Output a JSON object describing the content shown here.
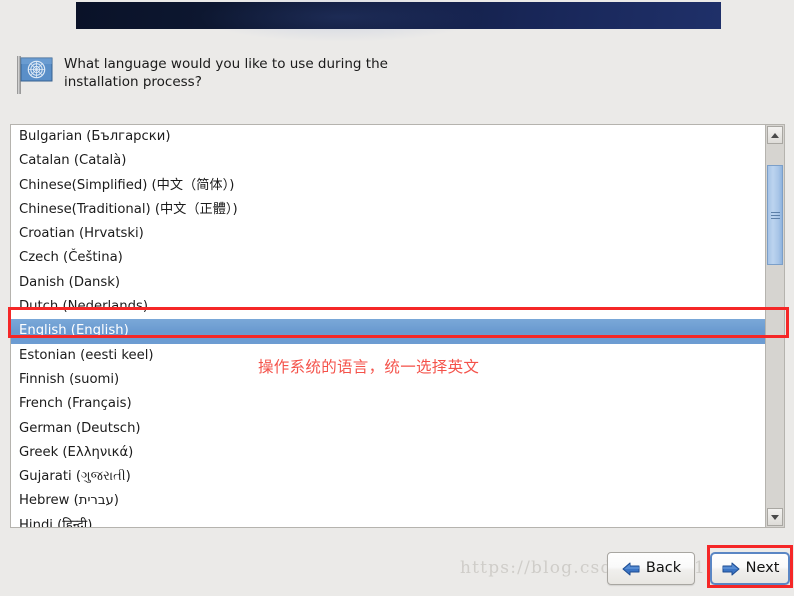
{
  "window": {
    "background_color": "#ebeae8",
    "banner_gradient_from": "#0a1228",
    "banner_gradient_to": "#1f3069"
  },
  "prompt": {
    "icon": "un-flag-icon",
    "text": "What language would you like to use during the installation process?"
  },
  "language_list": {
    "selected_value": "English (English)",
    "items": [
      "Bulgarian (Български)",
      "Catalan (Català)",
      "Chinese(Simplified) (中文（简体）)",
      "Chinese(Traditional) (中文（正體）)",
      "Croatian (Hrvatski)",
      "Czech (Čeština)",
      "Danish (Dansk)",
      "Dutch (Nederlands)",
      "English (English)",
      "Estonian (eesti keel)",
      "Finnish (suomi)",
      "French (Français)",
      "German (Deutsch)",
      "Greek (Ελληνικά)",
      "Gujarati (ગુજરાતી)",
      "Hebrew (עברית)",
      "Hindi (हिन्दी)"
    ],
    "selection_color": "#6d9cd2",
    "selection_text_color": "#ffffff"
  },
  "scrollbar": {
    "up_arrow": "chevron-up-icon",
    "down_arrow": "chevron-down-icon",
    "thumb_color": "#a8c5e7"
  },
  "annotations": {
    "box_color": "#f52727",
    "note_text": "操作系统的语言，统一选择英文",
    "note_color": "#f4524a"
  },
  "watermark": {
    "text": "https://blog.csdn.net/u012526411"
  },
  "buttons": {
    "back": {
      "label": "Back",
      "icon": "arrow-left-icon"
    },
    "next": {
      "label": "Next",
      "icon": "arrow-right-icon"
    }
  }
}
